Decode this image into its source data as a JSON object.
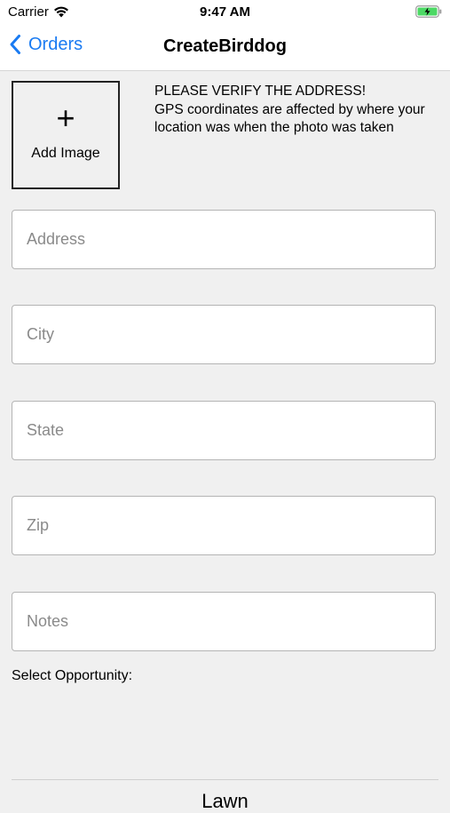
{
  "status_bar": {
    "carrier": "Carrier",
    "time": "9:47 AM",
    "icons": [
      "wifi-icon",
      "battery-charging-icon"
    ]
  },
  "nav": {
    "back_label": "Orders",
    "title": "CreateBirddog"
  },
  "add_image": {
    "icon": "plus-icon",
    "label": "Add Image"
  },
  "notice": {
    "heading": "PLEASE VERIFY THE ADDRESS!",
    "body": "GPS coordinates are affected by where your location was when the photo was taken"
  },
  "form": {
    "address_placeholder": "Address",
    "city_placeholder": "City",
    "state_placeholder": "State",
    "zip_placeholder": "Zip",
    "notes_placeholder": "Notes",
    "select_opportunity_label": "Select Opportunity:"
  },
  "bottom": {
    "button_label": "Lawn"
  },
  "colors": {
    "accent": "#1a7bf2",
    "battery": "#4cd964",
    "background": "#f0f0f0"
  }
}
